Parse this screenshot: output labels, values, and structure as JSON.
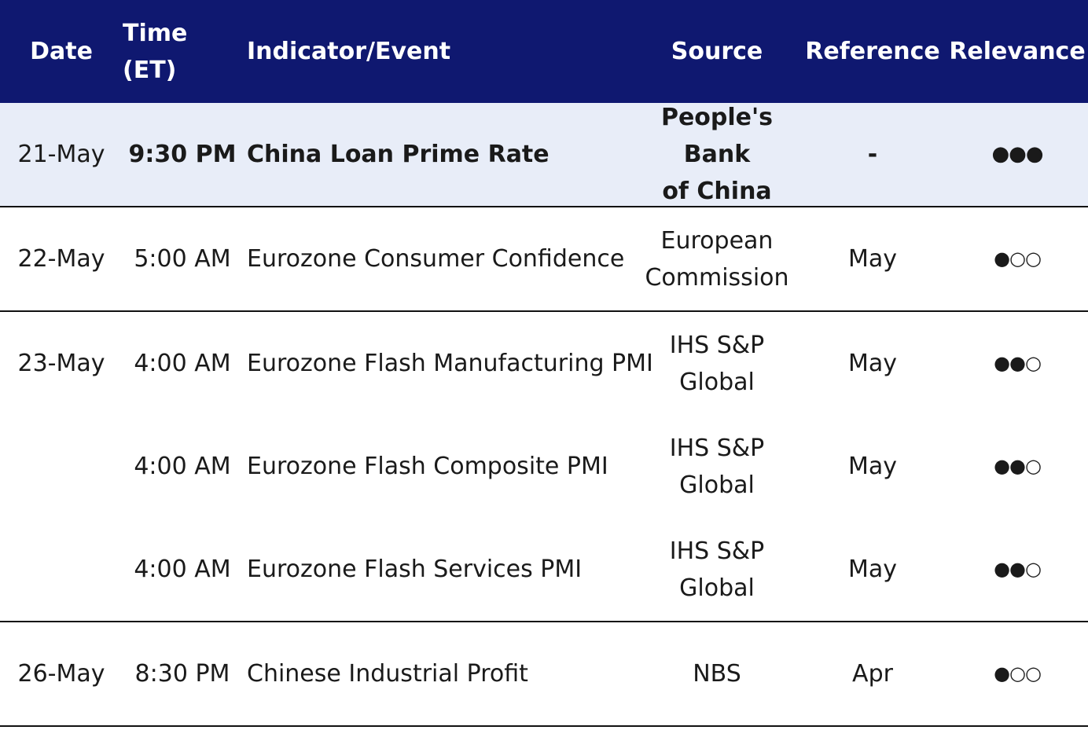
{
  "header": {
    "date": "Date",
    "time": "Time (ET)",
    "indicator": "Indicator/Event",
    "source": "Source",
    "reference": "Reference",
    "relevance": "Relevance"
  },
  "rows": [
    {
      "date": "21-May",
      "time": "9:30 PM",
      "indicator": "China Loan Prime Rate",
      "source_line1": "People's Bank",
      "source_line2": "of China",
      "reference": "-",
      "relevance": "●●●"
    },
    {
      "date": "22-May",
      "time": "5:00 AM",
      "indicator": "Eurozone Consumer Confidence",
      "source_line1": "European",
      "source_line2": "Commission",
      "reference": "May",
      "relevance": "●○○"
    },
    {
      "date": "23-May",
      "time": "4:00 AM",
      "indicator": "Eurozone Flash Manufacturing PMI",
      "source_line1": "IHS S&P",
      "source_line2": "Global",
      "reference": "May",
      "relevance": "●●○"
    },
    {
      "date": "",
      "time": "4:00 AM",
      "indicator": "Eurozone Flash Composite PMI",
      "source_line1": "IHS S&P",
      "source_line2": "Global",
      "reference": "May",
      "relevance": "●●○"
    },
    {
      "date": "",
      "time": "4:00 AM",
      "indicator": "Eurozone Flash Services PMI",
      "source_line1": "IHS S&P",
      "source_line2": "Global",
      "reference": "May",
      "relevance": "●●○"
    },
    {
      "date": "26-May",
      "time": "8:30 PM",
      "indicator": "Chinese Industrial Profit",
      "source_line1": "NBS",
      "source_line2": "",
      "reference": "Apr",
      "relevance": "●○○"
    }
  ],
  "colors": {
    "header_bg": "#0f1870",
    "highlight_row_bg": "#e8edf8",
    "divider": "#111111"
  }
}
